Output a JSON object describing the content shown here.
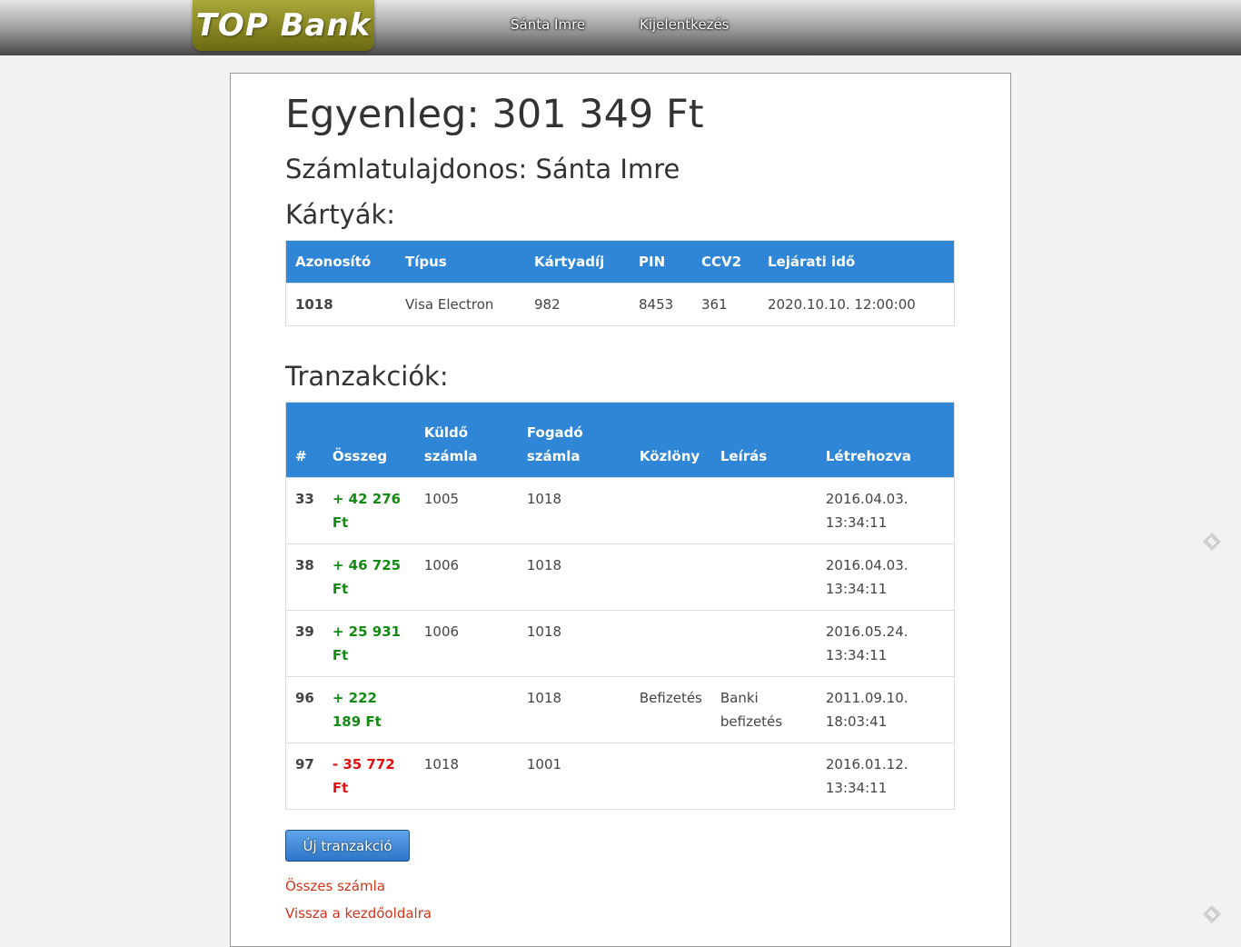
{
  "nav": {
    "logo": "TOP Bank",
    "user": "Sánta Imre",
    "logout": "Kijelentkezés"
  },
  "main": {
    "balance": "Egyenleg: 301 349 Ft",
    "owner": "Számlatulajdonos: Sánta Imre",
    "cards_title": "Kártyák:",
    "transactions_title": "Tranzakciók:"
  },
  "cards": {
    "headers": [
      "Azonosító",
      "Típus",
      "Kártyadíj",
      "PIN",
      "CCV2",
      "Lejárati idő"
    ],
    "rows": [
      [
        "1018",
        "Visa Electron",
        "982",
        "8453",
        "361",
        "2020.10.10. 12:00:00"
      ]
    ]
  },
  "transactions": {
    "headers": [
      "#",
      "Összeg",
      "Küldő számla",
      "Fogadó számla",
      "Közlöny",
      "Leírás",
      "Létrehozva"
    ],
    "rows": [
      {
        "id": "33",
        "amount": "+ 42 276 Ft",
        "sign": "pos",
        "sender": "1005",
        "receiver": "1018",
        "note": "",
        "description": "",
        "created": "2016.04.03. 13:34:11"
      },
      {
        "id": "38",
        "amount": "+ 46 725 Ft",
        "sign": "pos",
        "sender": "1006",
        "receiver": "1018",
        "note": "",
        "description": "",
        "created": "2016.04.03. 13:34:11"
      },
      {
        "id": "39",
        "amount": "+ 25 931 Ft",
        "sign": "pos",
        "sender": "1006",
        "receiver": "1018",
        "note": "",
        "description": "",
        "created": "2016.05.24. 13:34:11"
      },
      {
        "id": "96",
        "amount": "+ 222 189 Ft",
        "sign": "pos",
        "sender": "",
        "receiver": "1018",
        "note": "Befizetés",
        "description": "Banki befizetés",
        "created": "2011.09.10. 18:03:41"
      },
      {
        "id": "97",
        "amount": "- 35 772 Ft",
        "sign": "neg",
        "sender": "1018",
        "receiver": "1001",
        "note": "",
        "description": "",
        "created": "2016.01.12. 13:34:11"
      }
    ]
  },
  "actions": {
    "new_transaction": "Új tranzakció",
    "all_accounts": "Összes számla",
    "back_home": "Vissza a kezdőoldalra"
  },
  "colors": {
    "table_header": "#2f86d6",
    "positive": "#138a13",
    "negative": "#e01010",
    "link": "#d2341a"
  },
  "side_icons": [
    "feedly-icon",
    "feedly-icon"
  ]
}
